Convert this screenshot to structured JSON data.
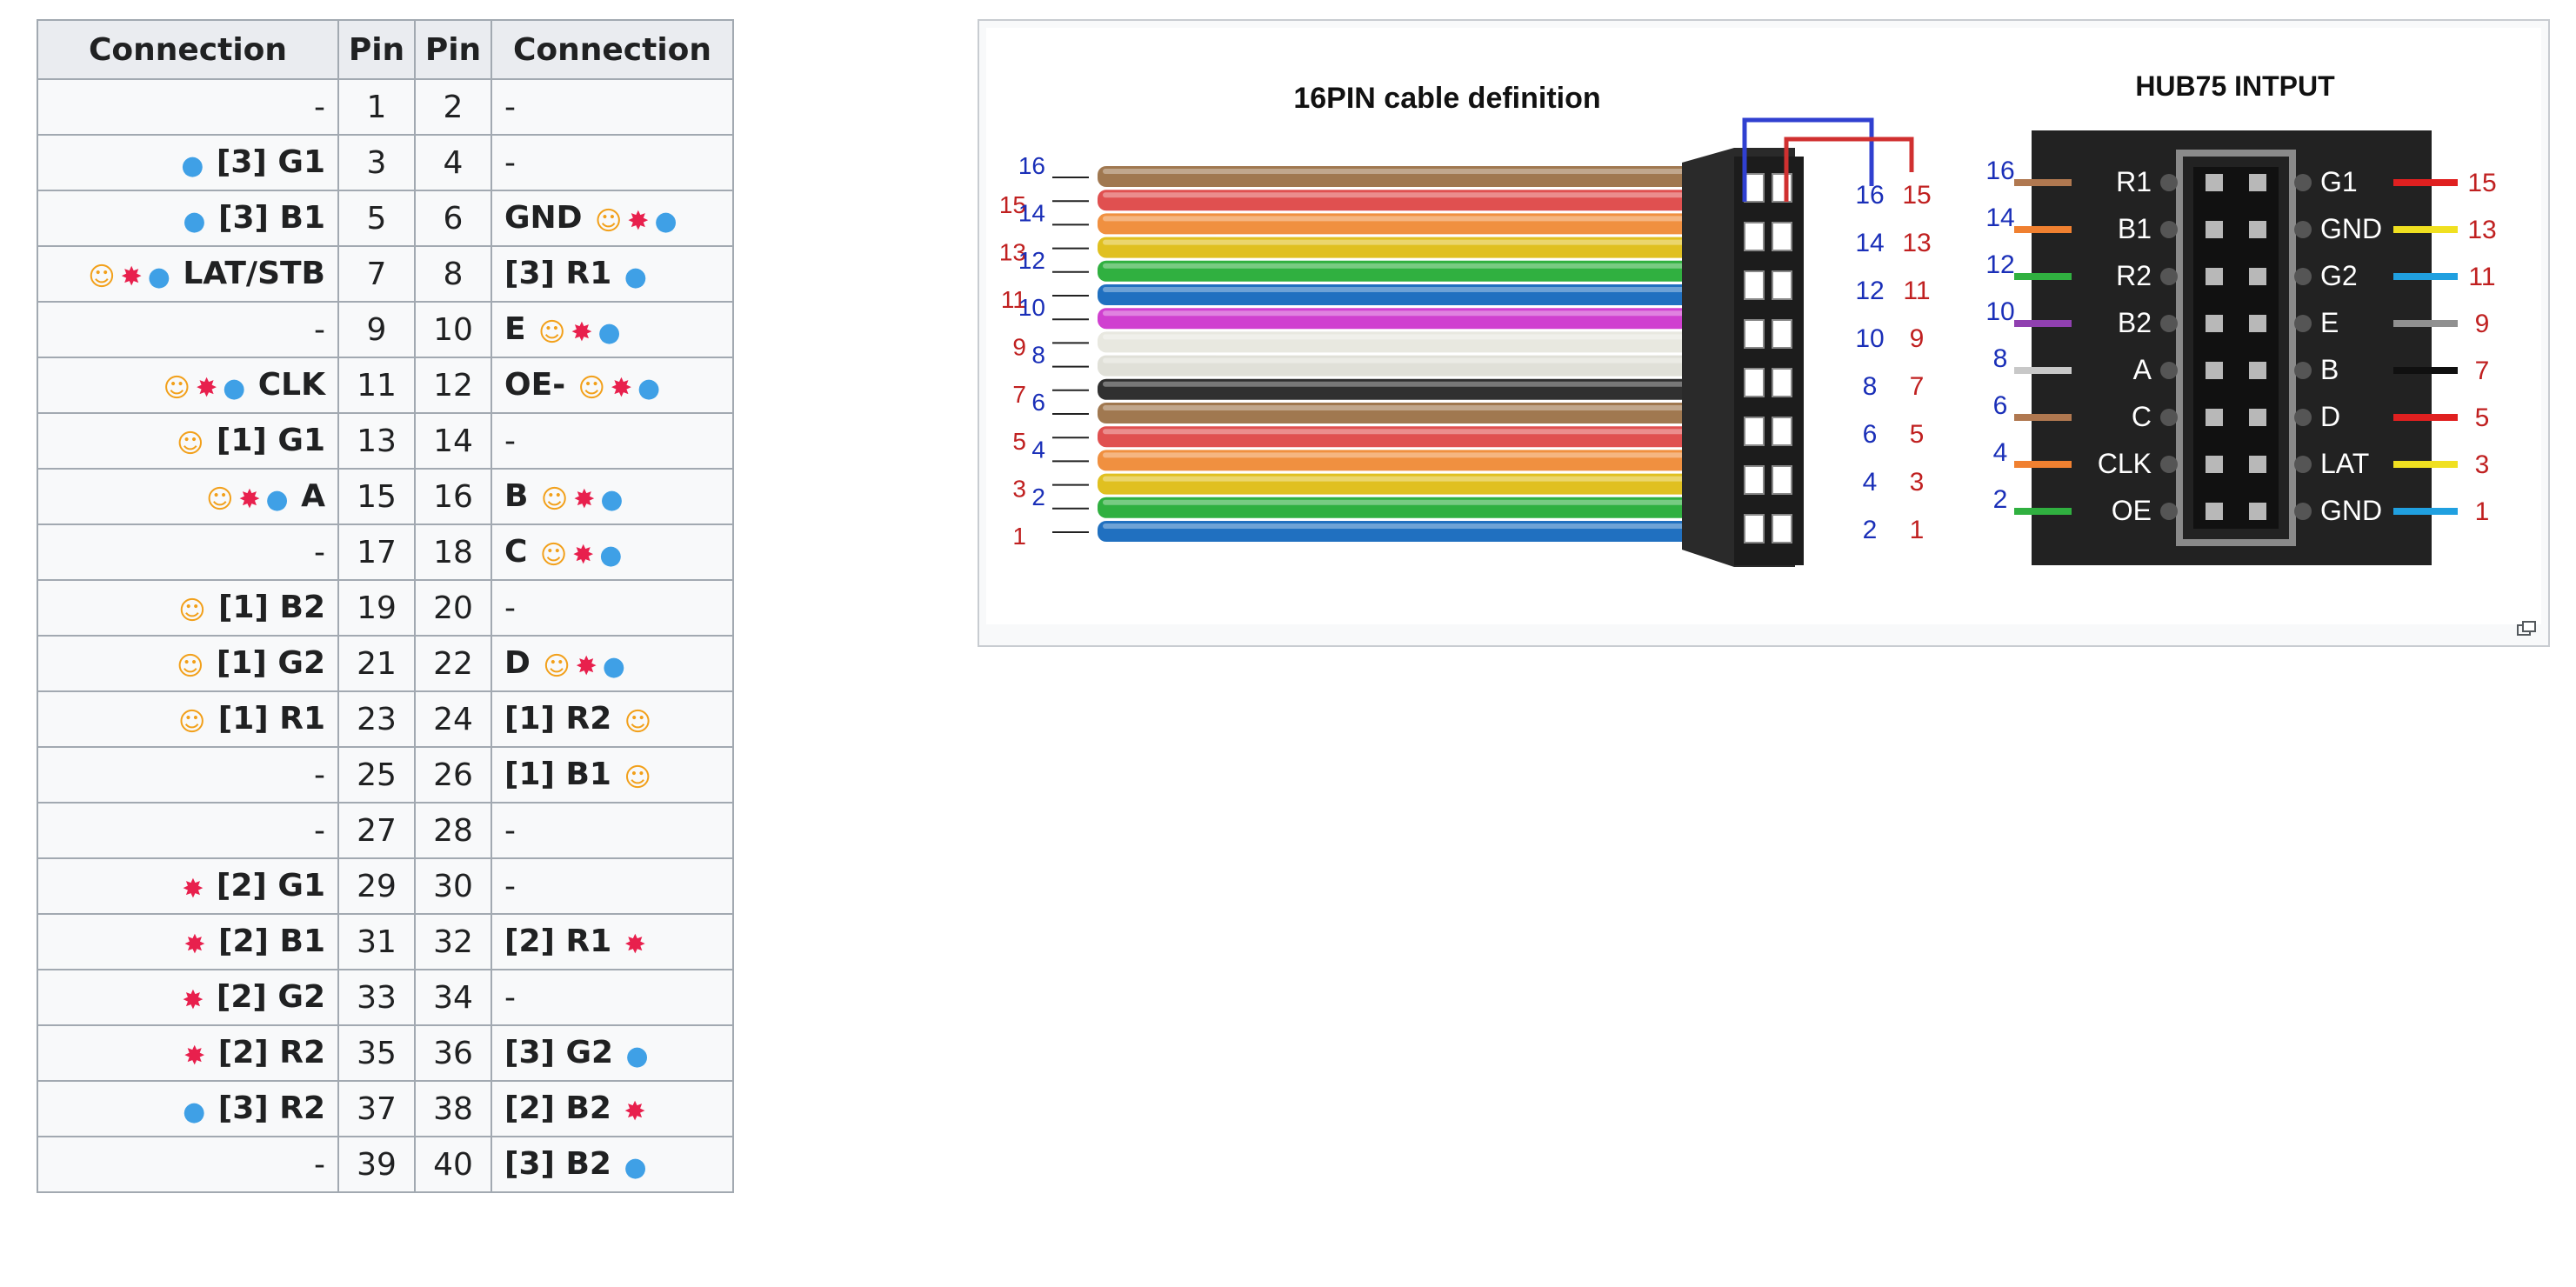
{
  "table": {
    "headers": [
      "Connection",
      "Pin",
      "Pin",
      "Connection"
    ],
    "rows": [
      {
        "left": "-",
        "lpin": "1",
        "rpin": "2",
        "right": "-",
        "li": [],
        "ri": []
      },
      {
        "left": "[3] G1",
        "lpin": "3",
        "rpin": "4",
        "right": "-",
        "li": [
          "drop"
        ],
        "ri": []
      },
      {
        "left": "[3] B1",
        "lpin": "5",
        "rpin": "6",
        "right": "GND",
        "li": [
          "drop"
        ],
        "ri": [
          "smile",
          "boom",
          "drop"
        ]
      },
      {
        "left": "LAT/STB",
        "lpin": "7",
        "rpin": "8",
        "right": "[3] R1",
        "li": [
          "smile",
          "boom",
          "drop"
        ],
        "ri": [
          "drop"
        ]
      },
      {
        "left": "-",
        "lpin": "9",
        "rpin": "10",
        "right": "E",
        "li": [],
        "ri": [
          "smile",
          "boom",
          "drop"
        ]
      },
      {
        "left": "CLK",
        "lpin": "11",
        "rpin": "12",
        "right": "OE-",
        "li": [
          "smile",
          "boom",
          "drop"
        ],
        "ri": [
          "smile",
          "boom",
          "drop"
        ]
      },
      {
        "left": "[1] G1",
        "lpin": "13",
        "rpin": "14",
        "right": "-",
        "li": [
          "smile"
        ],
        "ri": []
      },
      {
        "left": "A",
        "lpin": "15",
        "rpin": "16",
        "right": "B",
        "li": [
          "smile",
          "boom",
          "drop"
        ],
        "ri": [
          "smile",
          "boom",
          "drop"
        ]
      },
      {
        "left": "-",
        "lpin": "17",
        "rpin": "18",
        "right": "C",
        "li": [],
        "ri": [
          "smile",
          "boom",
          "drop"
        ]
      },
      {
        "left": "[1] B2",
        "lpin": "19",
        "rpin": "20",
        "right": "-",
        "li": [
          "smile"
        ],
        "ri": []
      },
      {
        "left": "[1] G2",
        "lpin": "21",
        "rpin": "22",
        "right": "D",
        "li": [
          "smile"
        ],
        "ri": [
          "smile",
          "boom",
          "drop"
        ]
      },
      {
        "left": "[1] R1",
        "lpin": "23",
        "rpin": "24",
        "right": "[1] R2",
        "li": [
          "smile"
        ],
        "ri": [
          "smile"
        ]
      },
      {
        "left": "-",
        "lpin": "25",
        "rpin": "26",
        "right": "[1] B1",
        "li": [],
        "ri": [
          "smile"
        ]
      },
      {
        "left": "-",
        "lpin": "27",
        "rpin": "28",
        "right": "-",
        "li": [],
        "ri": []
      },
      {
        "left": "[2] G1",
        "lpin": "29",
        "rpin": "30",
        "right": "-",
        "li": [
          "boom"
        ],
        "ri": []
      },
      {
        "left": "[2] B1",
        "lpin": "31",
        "rpin": "32",
        "right": "[2] R1",
        "li": [
          "boom"
        ],
        "ri": [
          "boom"
        ]
      },
      {
        "left": "[2] G2",
        "lpin": "33",
        "rpin": "34",
        "right": "-",
        "li": [
          "boom"
        ],
        "ri": []
      },
      {
        "left": "[2] R2",
        "lpin": "35",
        "rpin": "36",
        "right": "[3] G2",
        "li": [
          "boom"
        ],
        "ri": [
          "drop"
        ]
      },
      {
        "left": "[3] R2",
        "lpin": "37",
        "rpin": "38",
        "right": "[2] B2",
        "li": [
          "drop"
        ],
        "ri": [
          "boom"
        ]
      },
      {
        "left": "-",
        "lpin": "39",
        "rpin": "40",
        "right": "[3] B2",
        "li": [],
        "ri": [
          "drop"
        ]
      }
    ]
  },
  "icons": {
    "smile": {
      "name": "grinning-face-icon",
      "glyph": "☺"
    },
    "boom": {
      "name": "collision-icon",
      "glyph": "✸"
    },
    "drop": {
      "name": "droplet-icon",
      "glyph": "●"
    }
  },
  "figure": {
    "cable_title": "16PIN cable definition",
    "hub_title": "HUB75 INTPUT",
    "wire_colors": [
      "#a07850",
      "#e05050",
      "#f09040",
      "#e0c020",
      "#30b040",
      "#2070c0",
      "#d040d0",
      "#e8e8e0",
      "#e0e0d8",
      "#303030",
      "#a07850",
      "#e05050",
      "#f09040",
      "#e0c020",
      "#30b040",
      "#2070c0"
    ],
    "wire_labels_blue": [
      "16",
      "14",
      "12",
      "10",
      "8",
      "6",
      "4",
      "2"
    ],
    "wire_labels_red": [
      "15",
      "13",
      "11",
      "9",
      "7",
      "5",
      "3",
      "1"
    ],
    "connector_blue": [
      "16",
      "14",
      "12",
      "10",
      "8",
      "6",
      "4",
      "2"
    ],
    "connector_red": [
      "15",
      "13",
      "11",
      "9",
      "7",
      "5",
      "3",
      "1"
    ],
    "hub_left": [
      {
        "num": "16",
        "label": "R1",
        "color": "#b07850"
      },
      {
        "num": "14",
        "label": "B1",
        "color": "#f08030"
      },
      {
        "num": "12",
        "label": "R2",
        "color": "#30b040"
      },
      {
        "num": "10",
        "label": "B2",
        "color": "#9040b0"
      },
      {
        "num": "8",
        "label": "A",
        "color": "#c8c8c8"
      },
      {
        "num": "6",
        "label": "C",
        "color": "#b07850"
      },
      {
        "num": "4",
        "label": "CLK",
        "color": "#f08030"
      },
      {
        "num": "2",
        "label": "OE",
        "color": "#30b040"
      }
    ],
    "hub_right": [
      {
        "num": "15",
        "label": "G1",
        "color": "#e02020"
      },
      {
        "num": "13",
        "label": "GND",
        "color": "#f0e020"
      },
      {
        "num": "11",
        "label": "G2",
        "color": "#20a0e0"
      },
      {
        "num": "9",
        "label": "E",
        "color": "#909090"
      },
      {
        "num": "7",
        "label": "B",
        "color": "#101010"
      },
      {
        "num": "5",
        "label": "D",
        "color": "#e02020"
      },
      {
        "num": "3",
        "label": "LAT",
        "color": "#f0e020"
      },
      {
        "num": "1",
        "label": "GND",
        "color": "#20a0e0"
      }
    ]
  }
}
